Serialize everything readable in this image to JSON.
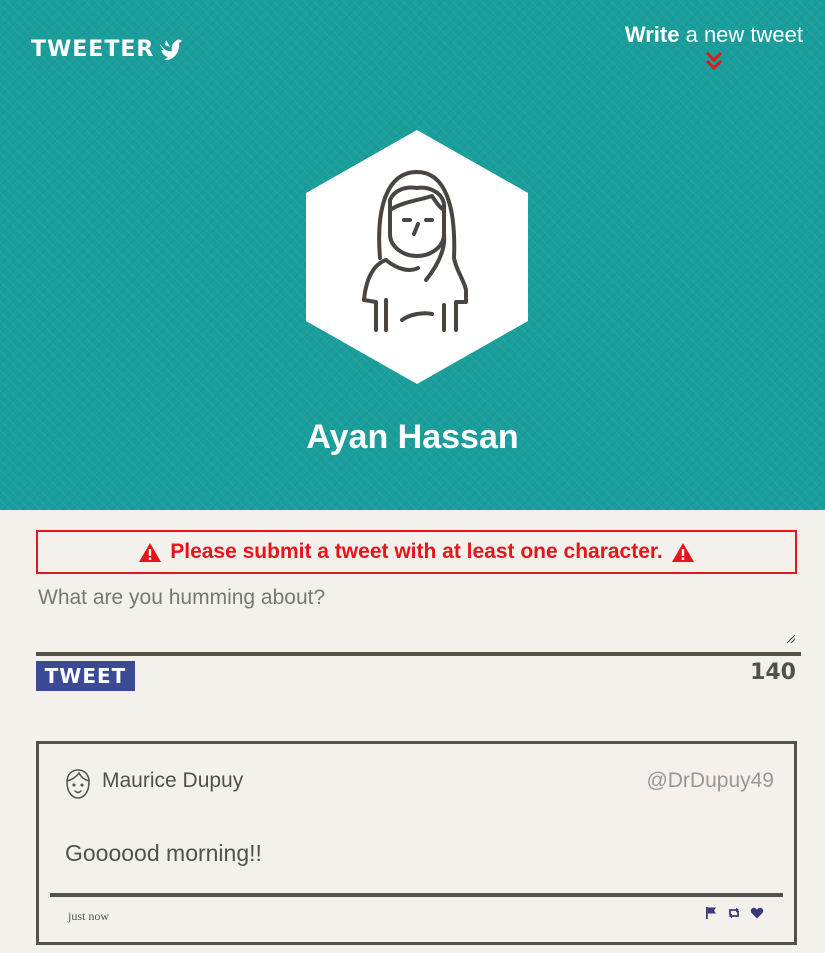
{
  "header": {
    "logo_text": "TWEETER",
    "write_bold": "Write",
    "write_rest": " a new tweet"
  },
  "profile": {
    "name": "Ayan Hassan"
  },
  "compose": {
    "error_message": "Please submit a tweet with at least one character.",
    "placeholder": "What are you humming about?",
    "submit_label": "TWEET",
    "char_counter": "140"
  },
  "tweets": [
    {
      "author": "Maurice Dupuy",
      "handle": "@DrDupuy49",
      "content": "Goooood morning!!",
      "timestamp": "just now",
      "actions": [
        "flag-icon",
        "retweet-icon",
        "heart-icon"
      ]
    }
  ],
  "colors": {
    "header_bg": "#1a9e9c",
    "page_bg": "#f4f1ec",
    "error": "#e8141b",
    "button": "#3a4a94",
    "text": "#545149",
    "chevron": "#e8141b"
  }
}
